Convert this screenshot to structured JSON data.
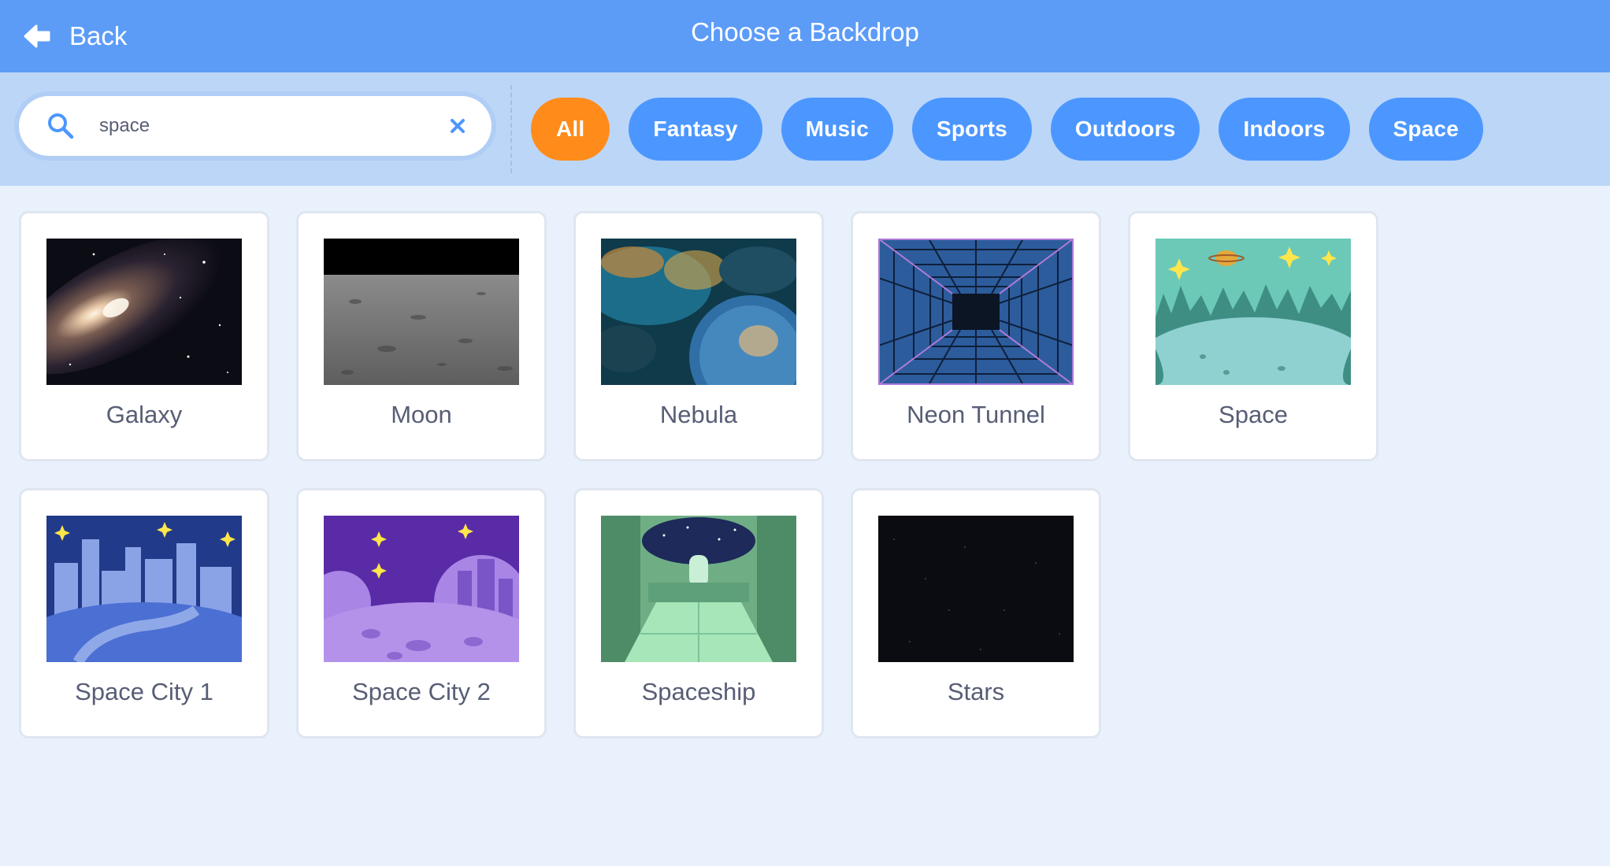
{
  "header": {
    "back_label": "Back",
    "title": "Choose a Backdrop",
    "background": "#5c9cf7"
  },
  "search": {
    "value": "space",
    "placeholder": "Search"
  },
  "tags": [
    {
      "label": "All",
      "active": true
    },
    {
      "label": "Fantasy",
      "active": false
    },
    {
      "label": "Music",
      "active": false
    },
    {
      "label": "Sports",
      "active": false
    },
    {
      "label": "Outdoors",
      "active": false
    },
    {
      "label": "Indoors",
      "active": false
    },
    {
      "label": "Space",
      "active": false
    }
  ],
  "colors": {
    "tag": "#4c97ff",
    "tag_active": "#ff8c1a",
    "page_bg": "#e9f1fc",
    "filter_bg": "#bcd6f8"
  },
  "backdrops": [
    {
      "name": "Galaxy",
      "thumb": "galaxy"
    },
    {
      "name": "Moon",
      "thumb": "moon"
    },
    {
      "name": "Nebula",
      "thumb": "nebula"
    },
    {
      "name": "Neon Tunnel",
      "thumb": "neon-tunnel"
    },
    {
      "name": "Space",
      "thumb": "space"
    },
    {
      "name": "Space City 1",
      "thumb": "space-city-1"
    },
    {
      "name": "Space City 2",
      "thumb": "space-city-2"
    },
    {
      "name": "Spaceship",
      "thumb": "spaceship"
    },
    {
      "name": "Stars",
      "thumb": "stars"
    }
  ]
}
